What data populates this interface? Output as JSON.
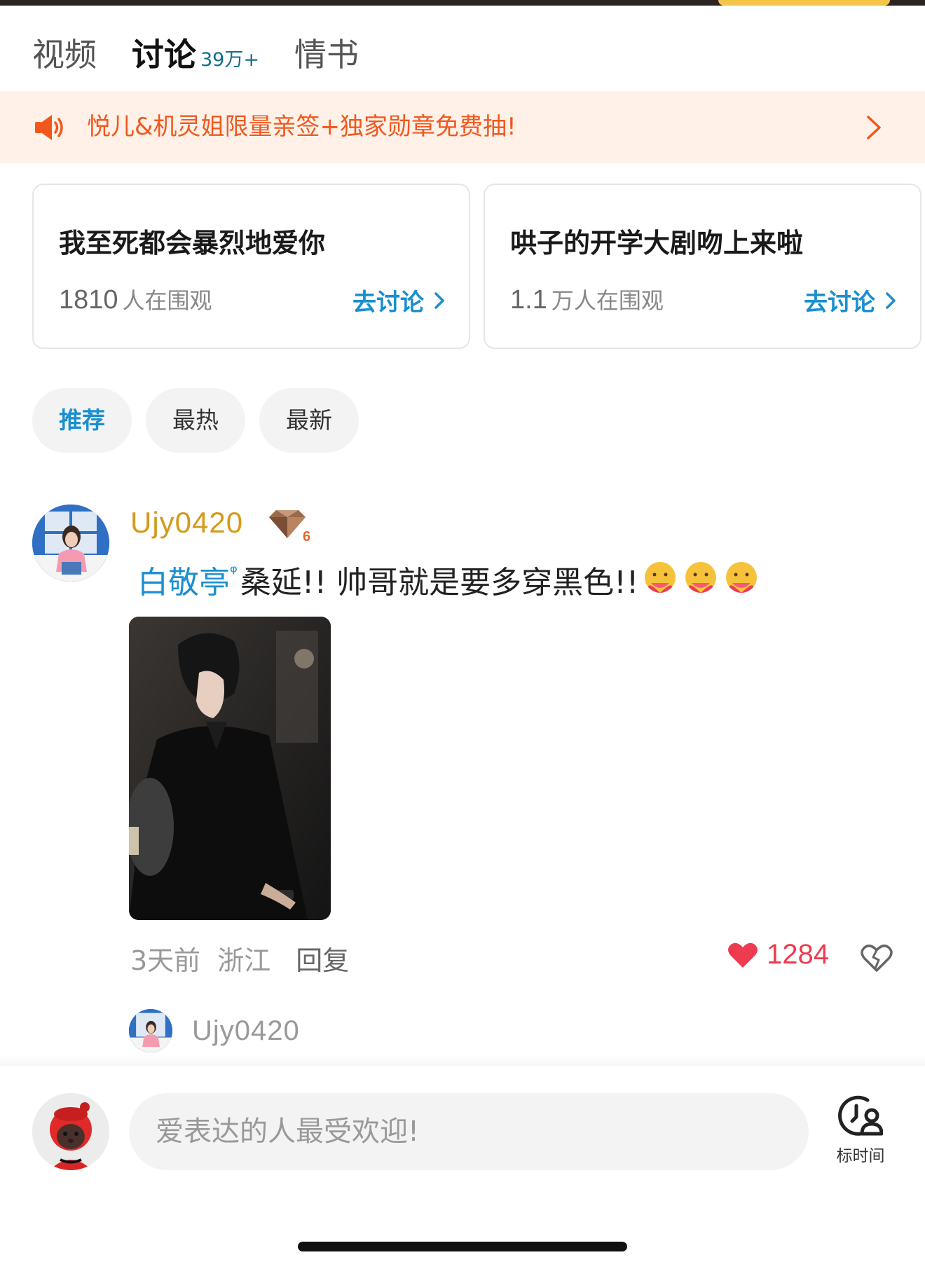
{
  "tabs": [
    {
      "label": "视频"
    },
    {
      "label": "讨论",
      "count": "39万+"
    },
    {
      "label": "情书"
    }
  ],
  "banner": {
    "text": "悦儿&机灵姐限量亲签+独家勋章免费抽!"
  },
  "topics": [
    {
      "title": "我至死都会暴烈地爱你",
      "count": "1810",
      "viewers": "人在围观",
      "action": "去讨论"
    },
    {
      "title": "哄子的开学大剧吻上来啦",
      "count": "1.1",
      "viewers": "万人在围观",
      "action": "去讨论"
    }
  ],
  "filters": [
    "推荐",
    "最热",
    "最新"
  ],
  "comment": {
    "username": "Ujy0420",
    "level": "6",
    "mention": "白敬亭",
    "text": "桑延!! 帅哥就是要多穿黑色!! ",
    "time": "3天前",
    "location": "浙江",
    "reply_label": "回复",
    "likes": "1284",
    "sub_reply_user": "Ujy0420"
  },
  "bottom": {
    "input_placeholder": "爱表达的人最受欢迎!",
    "time_label": "标时间"
  },
  "colors": {
    "accent_blue": "#1a8fd0",
    "banner_orange": "#f0581e",
    "username_gold": "#d49a1c",
    "like_red": "#ef3b4f"
  },
  "icons": [
    "speaker-icon",
    "chevron-right-icon",
    "level-badge-icon",
    "hug-emoji-icon",
    "heart-icon",
    "broken-heart-icon",
    "timestamp-icon"
  ]
}
